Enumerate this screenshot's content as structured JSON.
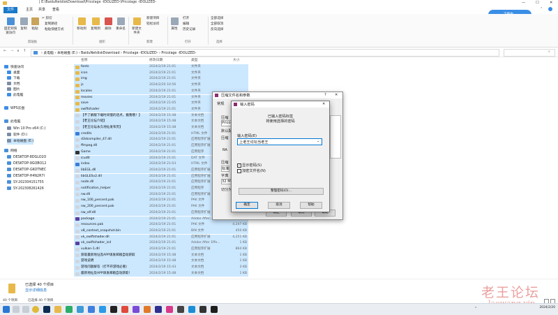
{
  "window": {
    "title": "| E:\\BaiduNetdiskDownload\\Pricolage -IDOLIZED-\\Pricolage -IDOLIZED-",
    "controls": [
      "—",
      "☐",
      "✕"
    ]
  },
  "tabs": [
    "文件",
    "主页",
    "共享",
    "查看"
  ],
  "download_badge": "下载中...",
  "ribbon": {
    "clipboard": {
      "pin": "固定到快速访问",
      "copy": "复制",
      "paste": "粘贴",
      "cut": "剪切",
      "copy_path": "复制路径",
      "paste_shortcut": "粘贴快捷方式",
      "group": "剪贴板"
    },
    "organize": {
      "move_to": "移动到",
      "copy_to": "复制到",
      "delete": "删除",
      "rename": "重命名",
      "group": "组织"
    },
    "new": {
      "new_folder": "新建文件夹",
      "new_item": "新建项目",
      "easy_access": "轻松访问",
      "group": "新建"
    },
    "open": {
      "properties": "属性",
      "open": "打开",
      "edit": "编辑",
      "history": "历史记录",
      "group": "打开"
    },
    "select": {
      "select_all": "全部选择",
      "select_none": "全部取消",
      "invert": "反向选择",
      "group": "选择"
    }
  },
  "address": {
    "crumbs": [
      "此电脑",
      "本地磁盘 (E:)",
      "BaiduNetdiskDownload",
      "Pricolage -IDOLIZED-",
      "Pricolage -IDOLIZED-"
    ],
    "sep": "›",
    "search_placeholder": "",
    "nav": [
      "←",
      "→",
      "∨",
      "↑"
    ]
  },
  "nav": [
    {
      "label": "快速访问",
      "color": "#3a8ee6"
    },
    {
      "label": "桌面",
      "color": "#3a8ee6"
    },
    {
      "label": "下载",
      "color": "#3a8ee6"
    },
    {
      "label": "文档",
      "color": "#7b8da6"
    },
    {
      "label": "图片",
      "color": "#7b8da6"
    },
    {
      "label": "此电脑",
      "color": "#3a8ee6"
    },
    {
      "label": "WPS云盘",
      "color": "#3a8ee6"
    },
    {
      "label": "此电脑",
      "color": "#4a90d9"
    },
    {
      "label": "Win 10 Pro x64 (C:)",
      "color": "#7b8da6"
    },
    {
      "label": "软件 (D:)",
      "color": "#7b8da6"
    },
    {
      "label": "本地磁盘 (E:)",
      "color": "#7b8da6"
    },
    {
      "label": "网络",
      "color": "#4a90d9"
    },
    {
      "label": "DESKTOP-8DGLO2O",
      "color": "#4a90d9"
    },
    {
      "label": "DESKTOP-9GOBO12",
      "color": "#4a90d9"
    },
    {
      "label": "DESKTOP-GKOTNEC",
      "color": "#4a90d9"
    },
    {
      "label": "DESKTOP-H4N2R7I",
      "color": "#4a90d9"
    },
    {
      "label": "SY-202304151755",
      "color": "#4a90d9"
    },
    {
      "label": "SY-202308261426",
      "color": "#4a90d9"
    }
  ],
  "columns": {
    "name": "名称",
    "date": "修改日期",
    "type": "类型",
    "size": "大小"
  },
  "files": [
    {
      "name": "fonts",
      "date": "2024/2/19 21:01",
      "type": "文件夹",
      "size": "",
      "icon": "#e8b94a"
    },
    {
      "name": "icon",
      "date": "2024/2/19 21:01",
      "type": "文件夹",
      "size": "",
      "icon": "#e8b94a"
    },
    {
      "name": "img",
      "date": "2024/2/19 21:01",
      "type": "文件夹",
      "size": "",
      "icon": "#e8b94a"
    },
    {
      "name": "js",
      "date": "2024/2/20 10:56",
      "type": "文件夹",
      "size": "",
      "icon": "#e8b94a"
    },
    {
      "name": "locales",
      "date": "2024/2/19 21:01",
      "type": "文件夹",
      "size": "",
      "icon": "#e8b94a"
    },
    {
      "name": "movies",
      "date": "2024/2/19 21:01",
      "type": "文件夹",
      "size": "",
      "icon": "#e8b94a"
    },
    {
      "name": "save",
      "date": "2024/2/19 21:05",
      "type": "文件夹",
      "size": "",
      "icon": "#e8b94a"
    },
    {
      "name": "swiftshader",
      "date": "2024/2/19 21:01",
      "type": "文件夹",
      "size": "",
      "icon": "#e8b94a"
    },
    {
      "name": "【不了解版下载时间慢的话点，戳我哦！】",
      "date": "2024/2/19 15:48",
      "type": "文本文档",
      "size": "1 KB",
      "icon": "#cfd6df"
    },
    {
      "name": "【老王论坛介绍】",
      "date": "2024/2/19 15:48",
      "type": "文本文档",
      "size": "1 KB",
      "icon": "#cfd6df"
    },
    {
      "name": "【老王论坛永久地址发布页】",
      "date": "2024/2/19 15:48",
      "type": "文本文档",
      "size": "1 KB",
      "icon": "#cfd6df"
    },
    {
      "name": "credits",
      "date": "2024/2/19 21:01",
      "type": "HTML 文件",
      "size": "",
      "icon": "#3b7dd8"
    },
    {
      "name": "d3dcompiler_47.dll",
      "date": "2024/2/19 21:01",
      "type": "应用程序扩展",
      "size": "",
      "icon": "#cfd6df"
    },
    {
      "name": "ffmpeg.dll",
      "date": "2024/2/19 21:01",
      "type": "应用程序扩展",
      "size": "",
      "icon": "#cfd6df"
    },
    {
      "name": "Game",
      "date": "2024/2/19 21:01",
      "type": "应用程序",
      "size": "",
      "icon": "#333333"
    },
    {
      "name": "icudtl",
      "date": "2024/2/19 21:01",
      "type": "DAT 文件",
      "size": "",
      "icon": "#cfd6df"
    },
    {
      "name": "index",
      "date": "2024/2/19 21:03",
      "type": "HTML 文件",
      "size": "",
      "icon": "#3b7dd8"
    },
    {
      "name": "libEGL.dll",
      "date": "2024/2/19 21:01",
      "type": "应用程序扩展",
      "size": "",
      "icon": "#cfd6df"
    },
    {
      "name": "libGLESv2.dll",
      "date": "2024/2/19 21:01",
      "type": "应用程序扩展",
      "size": "",
      "icon": "#cfd6df"
    },
    {
      "name": "node.dll",
      "date": "2024/2/19 21:01",
      "type": "应用程序扩展",
      "size": "",
      "icon": "#cfd6df"
    },
    {
      "name": "notification_helper",
      "date": "2024/2/19 21:01",
      "type": "应用程序",
      "size": "",
      "icon": "#cfd6df"
    },
    {
      "name": "nw.dll",
      "date": "2024/2/19 21:01",
      "type": "应用程序扩展",
      "size": "",
      "icon": "#cfd6df"
    },
    {
      "name": "nw_100_percent.pak",
      "date": "2024/2/19 21:01",
      "type": "PAK 文件",
      "size": "",
      "icon": "#cfd6df"
    },
    {
      "name": "nw_200_percent.pak",
      "date": "2024/2/19 21:01",
      "type": "PAK 文件",
      "size": "",
      "icon": "#cfd6df"
    },
    {
      "name": "nw_elf.dll",
      "date": "2024/2/19 21:01",
      "type": "应用程序扩展",
      "size": "",
      "icon": "#cfd6df"
    },
    {
      "name": "package",
      "date": "2024/2/19 21:01",
      "type": "Adobe After...",
      "size": "",
      "icon": "#5a3fa0"
    },
    {
      "name": "resources.pak",
      "date": "2024/2/19 21:01",
      "type": "PAK 文件",
      "size": "4,247 KB",
      "icon": "#cfd6df"
    },
    {
      "name": "v8_context_snapshot.bin",
      "date": "2024/2/19 21:01",
      "type": "BIN 文件",
      "size": "450 KB",
      "icon": "#cfd6df"
    },
    {
      "name": "vk_swiftshader.dll",
      "date": "2024/2/19 21:01",
      "type": "应用程序扩展",
      "size": "4,251 KB",
      "icon": "#cfd6df"
    },
    {
      "name": "vk_swiftshader_icd",
      "date": "2024/2/19 21:01",
      "type": "Adobe After Effe...",
      "size": "1 KB",
      "icon": "#5a3fa0"
    },
    {
      "name": "vulkan-1.dll",
      "date": "2024/2/19 21:01",
      "type": "应用程序扩展",
      "size": "864 KB",
      "icon": "#cfd6df"
    },
    {
      "name": "获取最新地址及APP请发邮箱自动获取",
      "date": "2024/2/19 15:48",
      "type": "文本文档",
      "size": "1 KB",
      "icon": "#cfd6df"
    },
    {
      "name": "游戏说明",
      "date": "2024/2/19 15:48",
      "type": "文本文档",
      "size": "1 KB",
      "icon": "#cfd6df"
    },
    {
      "name": "游戏问题解答（打不开游戏必看）",
      "date": "2024/2/19 15:43",
      "type": "文本文档",
      "size": "3 KB",
      "icon": "#cfd6df"
    },
    {
      "name": "最新地址及APP请发邮箱自动获取！",
      "date": "2024/2/19 15:48",
      "type": "文本文档",
      "size": "1 KB",
      "icon": "#cfd6df"
    }
  ],
  "infobar": {
    "title": "已选择 40 个项目",
    "link": "显示详细信息"
  },
  "status": {
    "count": "40 个项目",
    "selected": "已选择 40 个项目"
  },
  "archive_dialog": {
    "title": "压缩文件名和参数",
    "help": "?",
    "close": "✕",
    "tab": "常规",
    "labels": [
      "压缩",
      "Pricola",
      "默认配",
      "压缩",
      "RA",
      "压缩",
      "标准",
      "字典",
      "32 M",
      "切分为"
    ],
    "ok": "确定",
    "cancel": "取消",
    "help_btn": "帮助"
  },
  "password_dialog": {
    "title": "输入密码",
    "close": "✕",
    "heading1": "已输入密码标签",
    "heading2": "将使用选择的密码",
    "field_label": "输入密码(E)",
    "password": "上老王论坛当老王",
    "show_password": "显示密码(S)",
    "encrypt_names": "加密文件名(N)",
    "organize": "整理密码(O)...",
    "ok": "确定",
    "cancel": "取消",
    "help": "帮助"
  },
  "watermark": {
    "text": "老王论坛",
    "url": "laowang.vip"
  },
  "clock": {
    "time": "",
    "date": "2024/2/20"
  }
}
